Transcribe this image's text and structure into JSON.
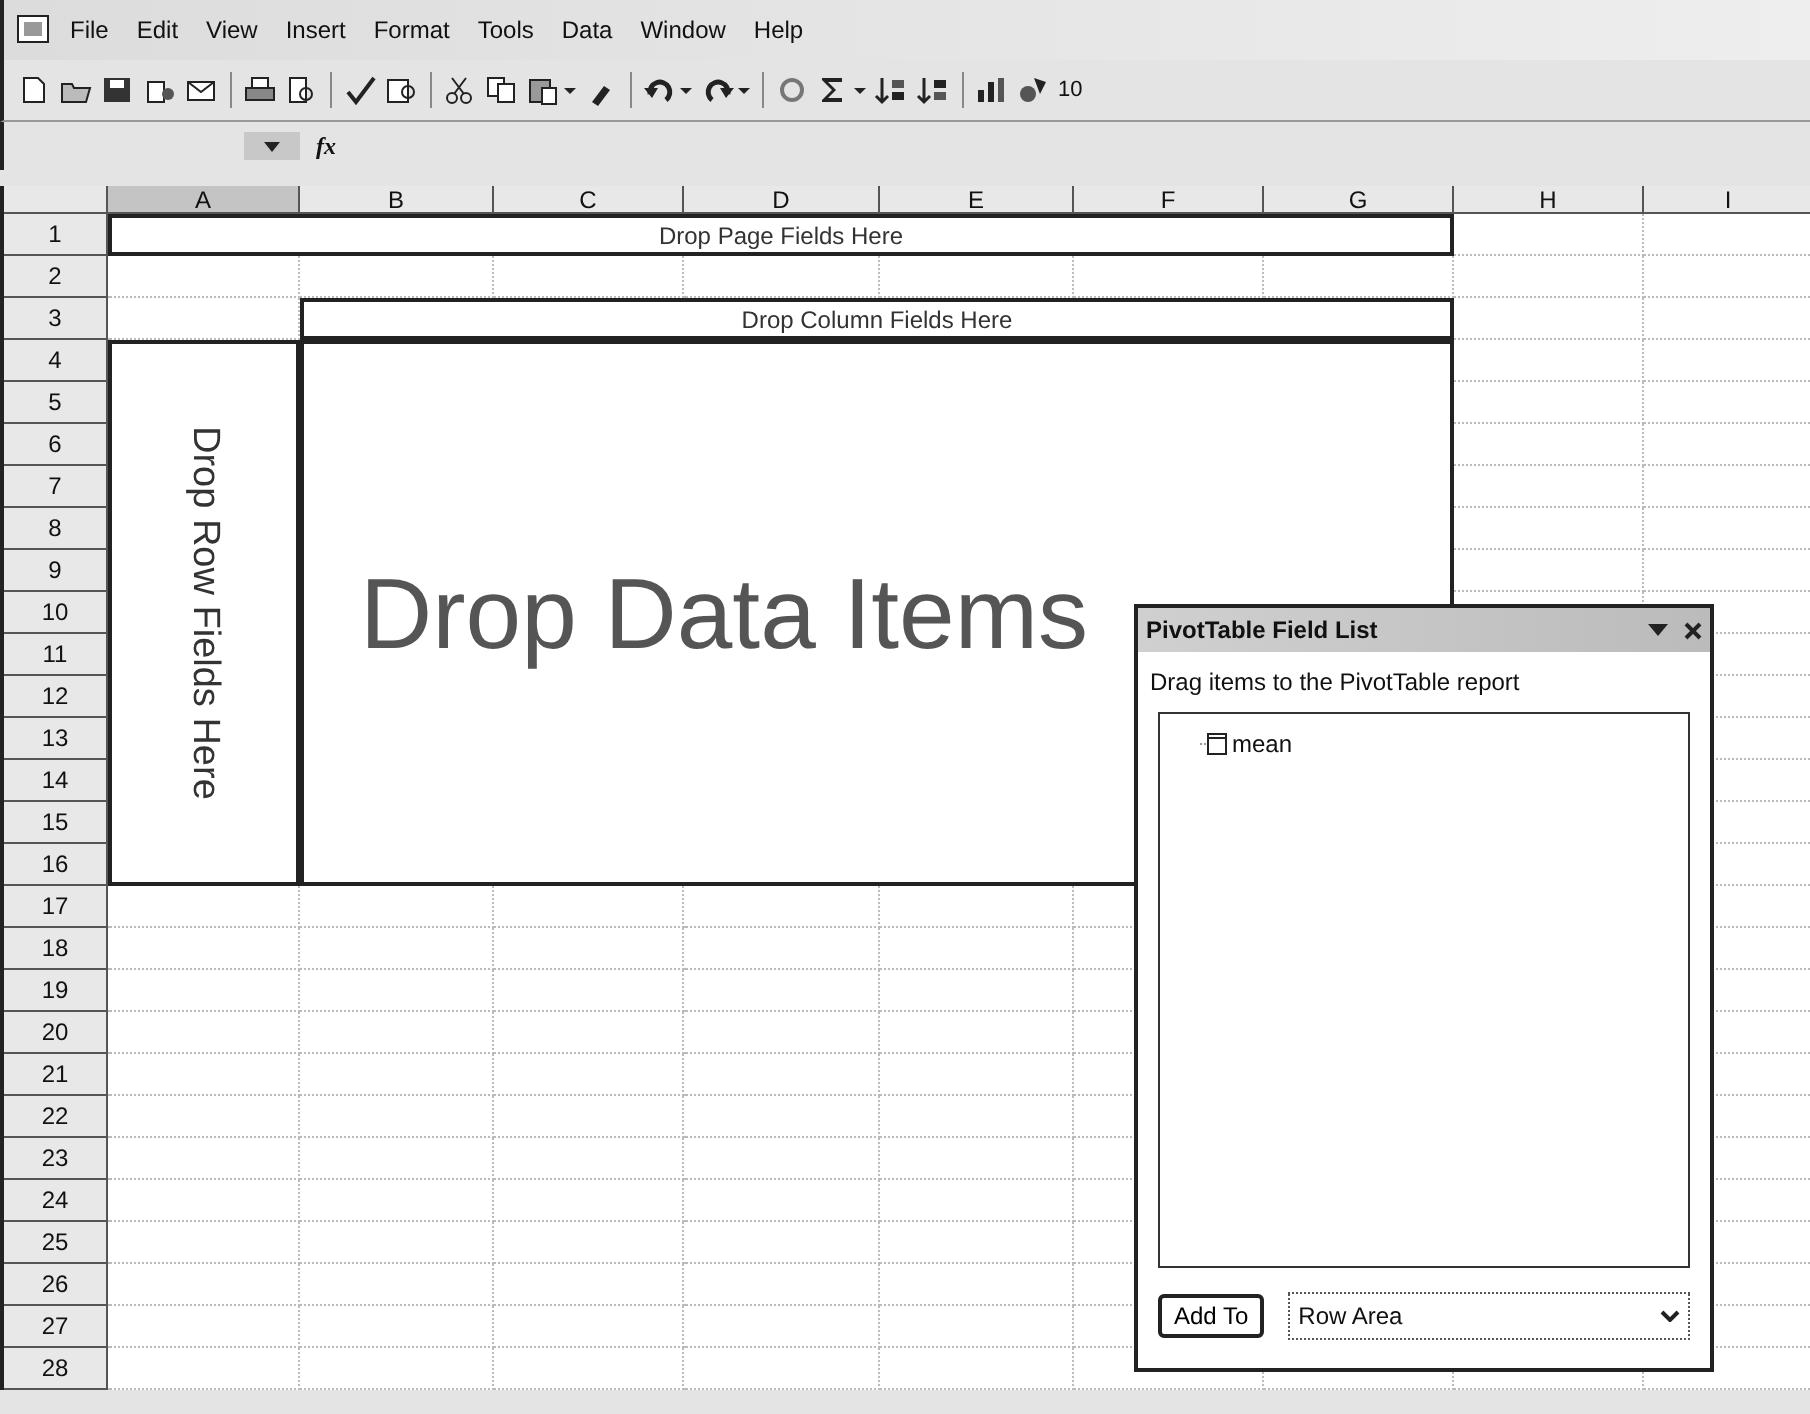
{
  "menu": [
    "File",
    "Edit",
    "View",
    "Insert",
    "Format",
    "Tools",
    "Data",
    "Window",
    "Help"
  ],
  "toolbar": {
    "zoom": "10"
  },
  "formula_bar": {
    "function_label": "fx"
  },
  "sheet": {
    "columns": [
      {
        "label": "A",
        "selected": true
      },
      {
        "label": "B",
        "selected": false
      },
      {
        "label": "C",
        "selected": false
      },
      {
        "label": "D",
        "selected": false
      },
      {
        "label": "E",
        "selected": false
      },
      {
        "label": "F",
        "selected": false
      },
      {
        "label": "G",
        "selected": false
      },
      {
        "label": "H",
        "selected": false
      },
      {
        "label": "I",
        "selected": false
      }
    ],
    "rows": [
      "1",
      "2",
      "3",
      "4",
      "5",
      "6",
      "7",
      "8",
      "9",
      "10",
      "11",
      "12",
      "13",
      "14",
      "15",
      "16",
      "17",
      "18",
      "19",
      "20",
      "21",
      "22",
      "23",
      "24",
      "25",
      "26",
      "27",
      "28"
    ]
  },
  "pivot": {
    "page_area": "Drop Page Fields Here",
    "column_area": "Drop Column Fields Here",
    "row_area": "Drop Row Fields Here",
    "data_area": "Drop Data Items"
  },
  "field_list": {
    "title": "PivotTable Field List",
    "instruction": "Drag items to the PivotTable report",
    "fields": [
      {
        "name": "mean"
      }
    ],
    "add_button": "Add To",
    "area": "Row Area"
  }
}
